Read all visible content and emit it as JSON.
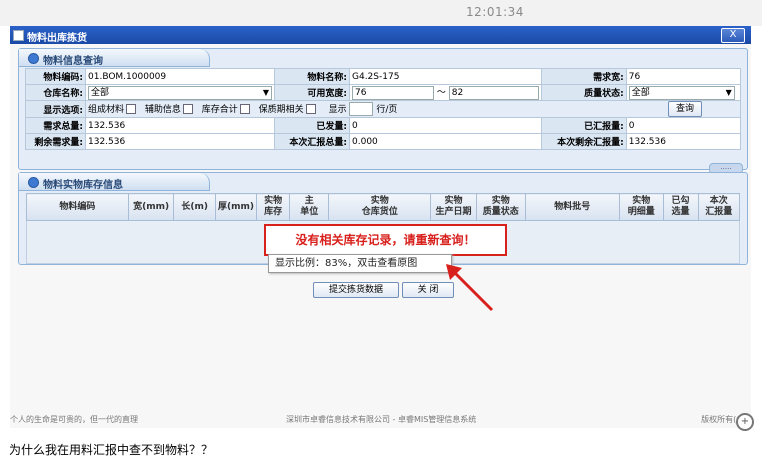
{
  "clock": "12:01:34",
  "window": {
    "title": "物料出库拣货",
    "close_label": "X"
  },
  "query_panel": {
    "title": "物料信息查询",
    "material_code_label": "物料编码:",
    "material_code": "01.BOM.1000009",
    "material_name_label": "物料名称:",
    "material_name": "G4.2S-175",
    "required_width_label": "需求宽:",
    "required_width": "76",
    "warehouse_label": "仓库名称:",
    "warehouse": "全部",
    "usable_width_label": "可用宽度:",
    "usable_width_from": "76",
    "range_sep": "～",
    "usable_width_to": "82",
    "quality_label": "质量状态:",
    "quality": "全部",
    "display_label": "显示选项:",
    "options": [
      "组成材料",
      "辅助信息",
      "库存合计",
      "保质期相关"
    ],
    "show_label": "显示",
    "show_rows": "",
    "rows_unit": "行/页",
    "query_button": "查询",
    "total_required_label": "需求总量:",
    "total_required": "132.536",
    "issued_label": "已发量:",
    "issued": "0",
    "reported_label": "已汇报量:",
    "reported": "0",
    "remaining_label": "剩余需求量:",
    "remaining": "132.536",
    "report_total_label": "本次汇报总量:",
    "report_total": "0.000",
    "remaining_after_label": "本次剩余汇报量:",
    "remaining_after": "132.536",
    "more": "....."
  },
  "stock_panel": {
    "title": "物料实物库存信息",
    "columns": [
      "物料编码",
      "宽(mm)",
      "长(m)",
      "厚(mm)",
      "实物\n库存",
      "主\n单位",
      "实物\n仓库货位",
      "实物\n生产日期",
      "实物\n质量状态",
      "物料批号",
      "实物\n明细量",
      "已勾\n选量",
      "本次\n汇报量"
    ]
  },
  "alert": "没有相关库存记录，请重新查询！",
  "tooltip": "显示比例：83%，双击查看原图",
  "buttons": {
    "submit": "提交拣货数据",
    "close": "关 闭"
  },
  "footer": {
    "left": "个人的生命是可贵的，但一代的直理",
    "center": "深圳市卓睿信息技术有限公司 - 卓睿MIS管理信息系统",
    "right": "版权所有(C)"
  },
  "question": "为什么我在用料汇报中查不到物料？？",
  "colors": {
    "title_bar": "#1b4aa6",
    "alert_red": "#d8201c",
    "panel_bg": "#e3ecf7"
  }
}
